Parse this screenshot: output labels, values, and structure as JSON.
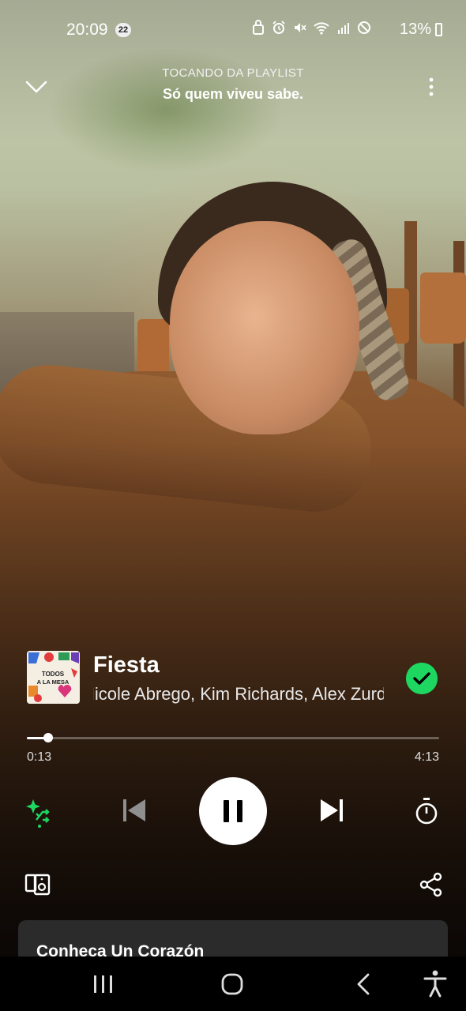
{
  "status_bar": {
    "time": "20:09",
    "notification_count": "22",
    "icons": [
      "lock-sync-icon",
      "alarm-icon",
      "mute-icon",
      "wifi-icon",
      "signal-icon",
      "dnd-icon"
    ],
    "battery_percent": "13%"
  },
  "header": {
    "context_label": "TOCANDO DA PLAYLIST",
    "playlist_name": "Só quem viveu sabe."
  },
  "track": {
    "title": "Fiesta",
    "artists": "Nicole Abrego, Kim Richards, Alex Zurdo",
    "liked": true,
    "cover_text": "TODOS A LA MESA"
  },
  "playback": {
    "elapsed": "0:13",
    "total": "4:13",
    "progress_fraction": 0.051,
    "state": "playing"
  },
  "lyrics_card": {
    "title": "Conheça Un Corazón"
  },
  "colors": {
    "accent": "#1ed760",
    "card": "#2b2b2b"
  }
}
